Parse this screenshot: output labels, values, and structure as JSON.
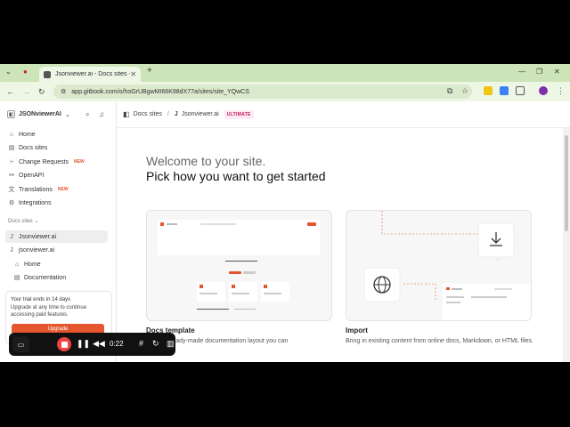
{
  "browser": {
    "tab_title": "Jsonviewer.ai - Docs sites - Git",
    "url": "app.gitbook.com/o/hoGrUBgwMI66K98dX77a/sites/site_YQwCS"
  },
  "sidebar": {
    "org_name": "JSONviewerAI",
    "items": [
      {
        "label": "Home",
        "icon": "home-icon"
      },
      {
        "label": "Docs sites",
        "icon": "book-icon"
      },
      {
        "label": "Change Requests",
        "icon": "branch-icon",
        "badge": "NEW"
      },
      {
        "label": "OpenAPI",
        "icon": "api-icon"
      },
      {
        "label": "Translations",
        "icon": "translate-icon",
        "badge": "NEW"
      },
      {
        "label": "Integrations",
        "icon": "integrations-icon"
      }
    ],
    "section_label": "Docs sites",
    "sites": [
      {
        "label": "Jsonviewer.ai",
        "selected": true
      },
      {
        "label": "jsonviewer.ai",
        "selected": false
      }
    ],
    "site_pages": [
      "Home",
      "Documentation"
    ],
    "trial": {
      "title": "Your trial ends in 14 days",
      "text": "Upgrade at any time to continue accessing paid features.",
      "button": "Upgrade"
    }
  },
  "breadcrumb": {
    "root": "Docs sites",
    "site": "Jsonviewer.ai",
    "plan_badge": "ULTIMATE"
  },
  "main": {
    "welcome": "Welcome to your site.",
    "pick": "Pick how you want to get started",
    "cards": [
      {
        "title": "Docs template",
        "desc": "ready-made documentation layout you can"
      },
      {
        "title": "Import",
        "desc": "Bring in existing content from online docs, Markdown, or HTML files."
      }
    ]
  },
  "recorder": {
    "time": "0:22"
  },
  "colors": {
    "accent": "#e4572e",
    "tabbar": "#cde4b8",
    "addrbar": "#eef7e6",
    "ultimate": "#c2185b"
  }
}
